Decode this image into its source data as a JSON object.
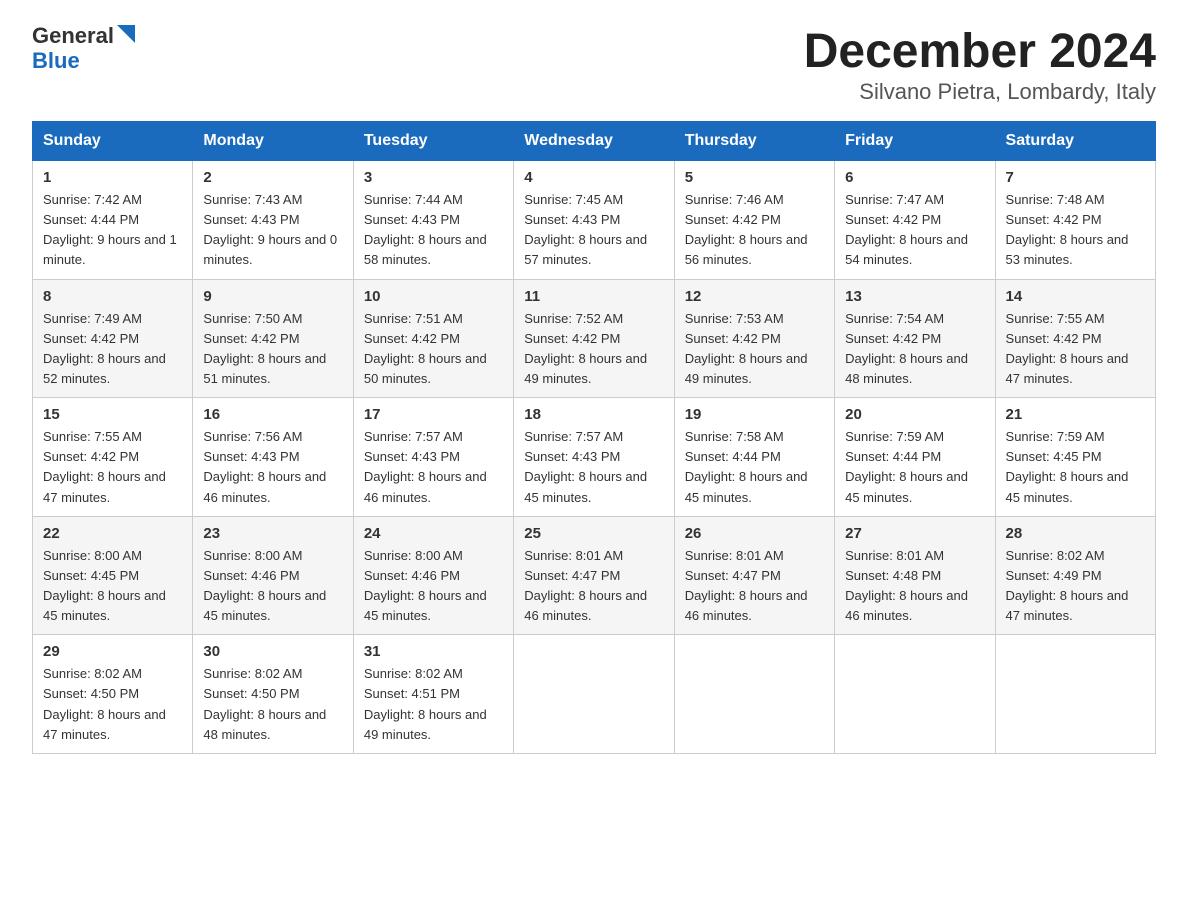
{
  "header": {
    "logo_line1": "General",
    "logo_line2": "Blue",
    "title": "December 2024",
    "subtitle": "Silvano Pietra, Lombardy, Italy"
  },
  "days_of_week": [
    "Sunday",
    "Monday",
    "Tuesday",
    "Wednesday",
    "Thursday",
    "Friday",
    "Saturday"
  ],
  "weeks": [
    [
      {
        "day": "1",
        "sunrise": "7:42 AM",
        "sunset": "4:44 PM",
        "daylight": "9 hours and 1 minute."
      },
      {
        "day": "2",
        "sunrise": "7:43 AM",
        "sunset": "4:43 PM",
        "daylight": "9 hours and 0 minutes."
      },
      {
        "day": "3",
        "sunrise": "7:44 AM",
        "sunset": "4:43 PM",
        "daylight": "8 hours and 58 minutes."
      },
      {
        "day": "4",
        "sunrise": "7:45 AM",
        "sunset": "4:43 PM",
        "daylight": "8 hours and 57 minutes."
      },
      {
        "day": "5",
        "sunrise": "7:46 AM",
        "sunset": "4:42 PM",
        "daylight": "8 hours and 56 minutes."
      },
      {
        "day": "6",
        "sunrise": "7:47 AM",
        "sunset": "4:42 PM",
        "daylight": "8 hours and 54 minutes."
      },
      {
        "day": "7",
        "sunrise": "7:48 AM",
        "sunset": "4:42 PM",
        "daylight": "8 hours and 53 minutes."
      }
    ],
    [
      {
        "day": "8",
        "sunrise": "7:49 AM",
        "sunset": "4:42 PM",
        "daylight": "8 hours and 52 minutes."
      },
      {
        "day": "9",
        "sunrise": "7:50 AM",
        "sunset": "4:42 PM",
        "daylight": "8 hours and 51 minutes."
      },
      {
        "day": "10",
        "sunrise": "7:51 AM",
        "sunset": "4:42 PM",
        "daylight": "8 hours and 50 minutes."
      },
      {
        "day": "11",
        "sunrise": "7:52 AM",
        "sunset": "4:42 PM",
        "daylight": "8 hours and 49 minutes."
      },
      {
        "day": "12",
        "sunrise": "7:53 AM",
        "sunset": "4:42 PM",
        "daylight": "8 hours and 49 minutes."
      },
      {
        "day": "13",
        "sunrise": "7:54 AM",
        "sunset": "4:42 PM",
        "daylight": "8 hours and 48 minutes."
      },
      {
        "day": "14",
        "sunrise": "7:55 AM",
        "sunset": "4:42 PM",
        "daylight": "8 hours and 47 minutes."
      }
    ],
    [
      {
        "day": "15",
        "sunrise": "7:55 AM",
        "sunset": "4:42 PM",
        "daylight": "8 hours and 47 minutes."
      },
      {
        "day": "16",
        "sunrise": "7:56 AM",
        "sunset": "4:43 PM",
        "daylight": "8 hours and 46 minutes."
      },
      {
        "day": "17",
        "sunrise": "7:57 AM",
        "sunset": "4:43 PM",
        "daylight": "8 hours and 46 minutes."
      },
      {
        "day": "18",
        "sunrise": "7:57 AM",
        "sunset": "4:43 PM",
        "daylight": "8 hours and 45 minutes."
      },
      {
        "day": "19",
        "sunrise": "7:58 AM",
        "sunset": "4:44 PM",
        "daylight": "8 hours and 45 minutes."
      },
      {
        "day": "20",
        "sunrise": "7:59 AM",
        "sunset": "4:44 PM",
        "daylight": "8 hours and 45 minutes."
      },
      {
        "day": "21",
        "sunrise": "7:59 AM",
        "sunset": "4:45 PM",
        "daylight": "8 hours and 45 minutes."
      }
    ],
    [
      {
        "day": "22",
        "sunrise": "8:00 AM",
        "sunset": "4:45 PM",
        "daylight": "8 hours and 45 minutes."
      },
      {
        "day": "23",
        "sunrise": "8:00 AM",
        "sunset": "4:46 PM",
        "daylight": "8 hours and 45 minutes."
      },
      {
        "day": "24",
        "sunrise": "8:00 AM",
        "sunset": "4:46 PM",
        "daylight": "8 hours and 45 minutes."
      },
      {
        "day": "25",
        "sunrise": "8:01 AM",
        "sunset": "4:47 PM",
        "daylight": "8 hours and 46 minutes."
      },
      {
        "day": "26",
        "sunrise": "8:01 AM",
        "sunset": "4:47 PM",
        "daylight": "8 hours and 46 minutes."
      },
      {
        "day": "27",
        "sunrise": "8:01 AM",
        "sunset": "4:48 PM",
        "daylight": "8 hours and 46 minutes."
      },
      {
        "day": "28",
        "sunrise": "8:02 AM",
        "sunset": "4:49 PM",
        "daylight": "8 hours and 47 minutes."
      }
    ],
    [
      {
        "day": "29",
        "sunrise": "8:02 AM",
        "sunset": "4:50 PM",
        "daylight": "8 hours and 47 minutes."
      },
      {
        "day": "30",
        "sunrise": "8:02 AM",
        "sunset": "4:50 PM",
        "daylight": "8 hours and 48 minutes."
      },
      {
        "day": "31",
        "sunrise": "8:02 AM",
        "sunset": "4:51 PM",
        "daylight": "8 hours and 49 minutes."
      },
      null,
      null,
      null,
      null
    ]
  ]
}
